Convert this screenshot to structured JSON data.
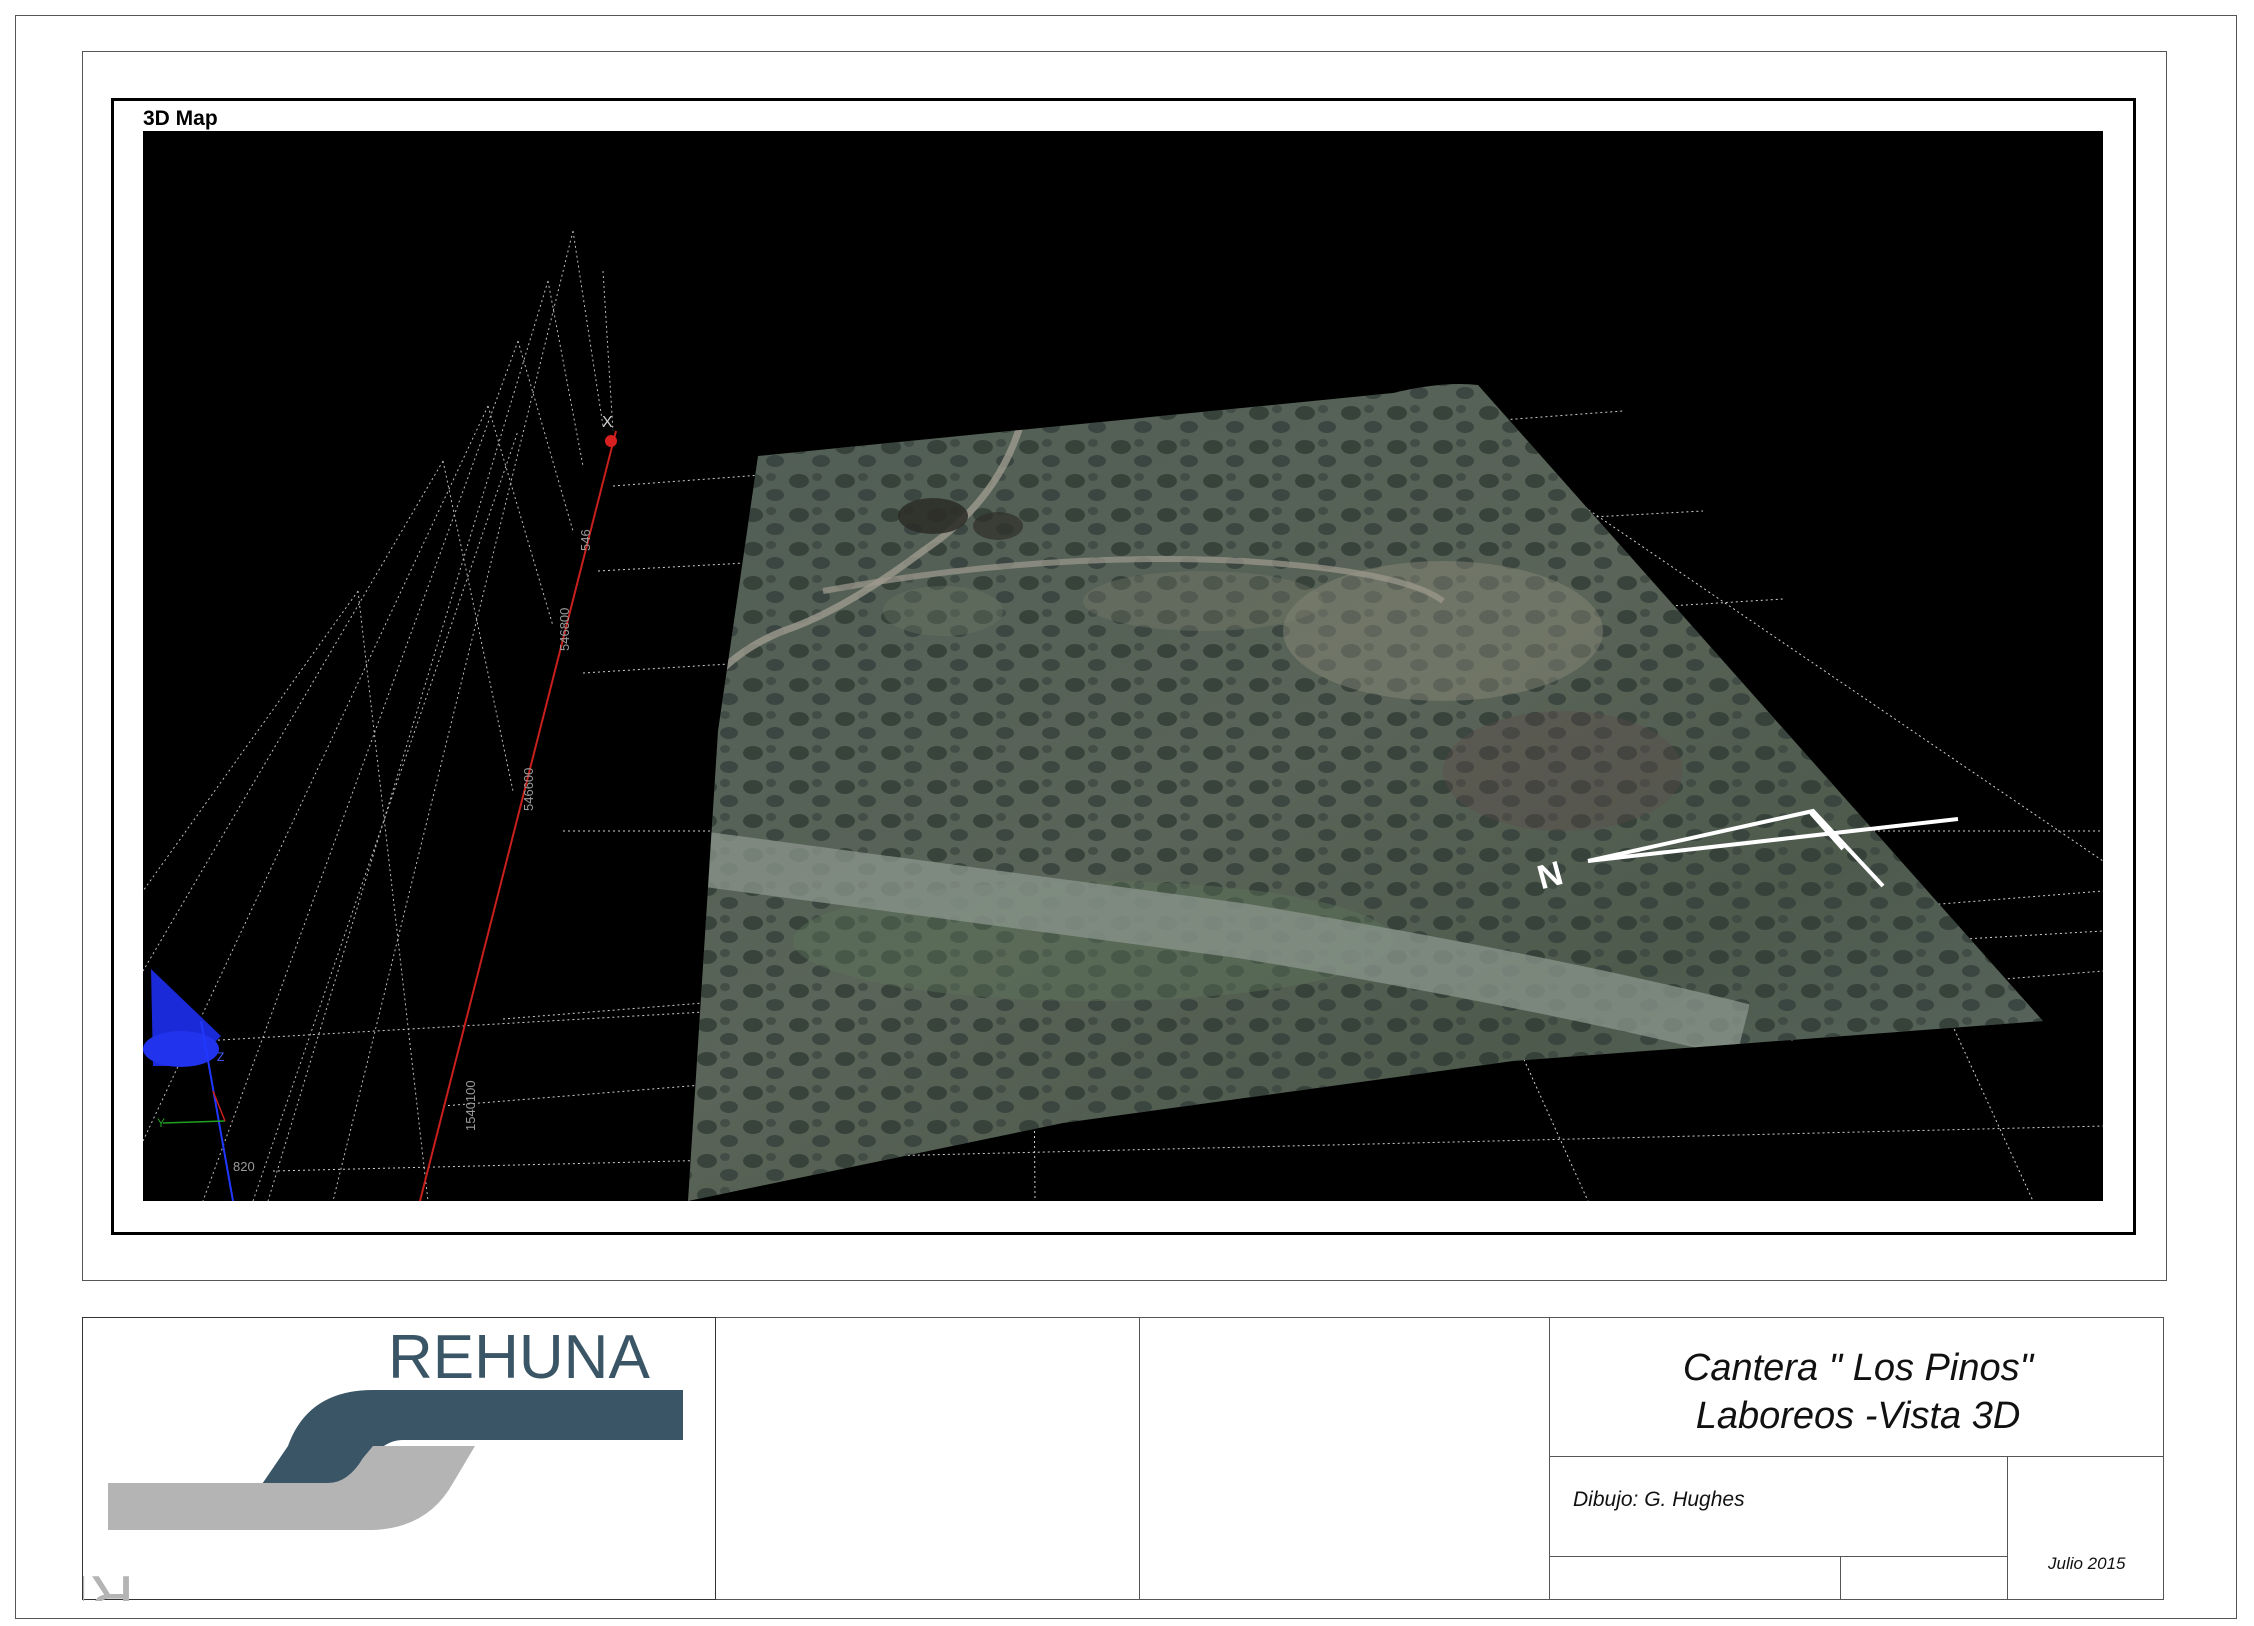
{
  "map": {
    "title": "3D Map",
    "axis_labels": {
      "x": "X",
      "y": "Y",
      "z": "Z",
      "tick_820": "820",
      "tick_1540100": "1540100"
    },
    "north_label": "N"
  },
  "titleblock": {
    "logo_text": "REHUNA",
    "project_title_line1": "Cantera \" Los Pinos\"",
    "project_title_line2": "Laboreos -Vista 3D",
    "drawn_by": "Dibujo: G. Hughes",
    "date": "Julio 2015"
  },
  "colors": {
    "logo_dark": "#3a5566",
    "logo_light": "#b4b4b4",
    "axis_red": "#c8201c",
    "axis_blue": "#1a2ad8"
  }
}
